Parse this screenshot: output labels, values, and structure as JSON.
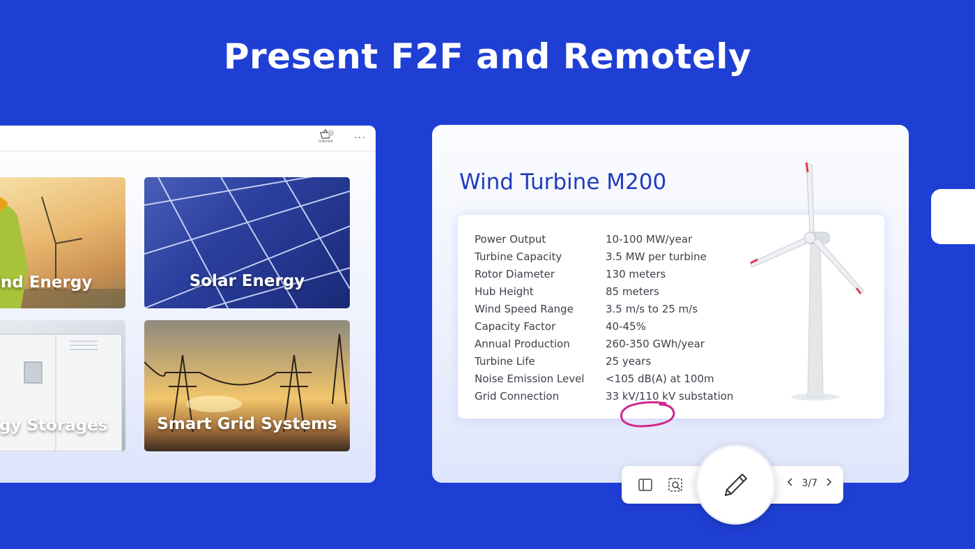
{
  "headline": "Present F2F and Remotely",
  "app_window": {
    "collected_label": "Collected",
    "collected_count": "0",
    "more_label": "···",
    "tiles": [
      {
        "label": "Wind Energy"
      },
      {
        "label": "Solar Energy"
      },
      {
        "label": "Energy Storages"
      },
      {
        "label": "Smart Grid Systems"
      }
    ]
  },
  "slide": {
    "title": "Wind Turbine M200",
    "specs": [
      {
        "key": "Power Output",
        "value": "10-100 MW/year"
      },
      {
        "key": "Turbine Capacity",
        "value": "3.5 MW per turbine"
      },
      {
        "key": "Rotor Diameter",
        "value": "130 meters"
      },
      {
        "key": "Hub Height",
        "value": "85 meters"
      },
      {
        "key": "Wind Speed Range",
        "value": "3.5 m/s to 25 m/s"
      },
      {
        "key": "Capacity Factor",
        "value": "40-45%"
      },
      {
        "key": "Annual Production",
        "value": "260-350 GWh/year"
      },
      {
        "key": "Turbine Life",
        "value": "25 years"
      },
      {
        "key": "Noise Emission Level",
        "value": "<105 dB(A) at 100m"
      },
      {
        "key": "Grid Connection",
        "value": "33 kV/110 kV substation"
      }
    ],
    "annotation_color": "#d0268f"
  },
  "toolbar": {
    "page_current": "3",
    "page_total": "7",
    "page_label": "3/7",
    "icons": [
      "sidebar-panel-icon",
      "zoom-region-icon",
      "pen-icon",
      "chevron-left-icon",
      "chevron-right-icon"
    ]
  },
  "colors": {
    "background": "#1f3fd4",
    "title_blue": "#1f3bbd"
  }
}
